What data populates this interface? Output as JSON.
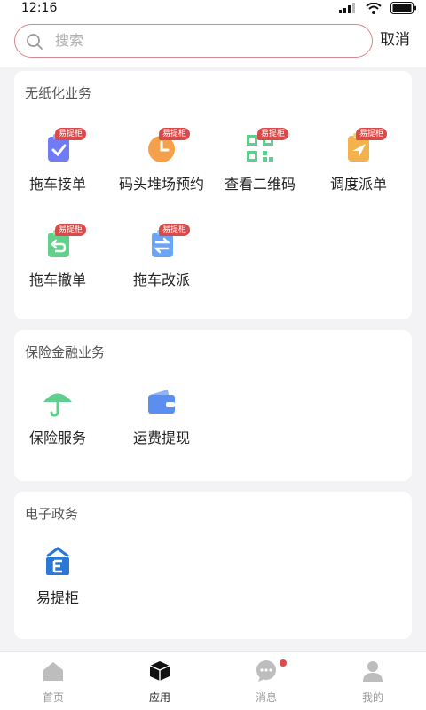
{
  "statusbar": {
    "time": "12:16"
  },
  "search": {
    "placeholder": "搜索",
    "cancel_label": "取消"
  },
  "sections": [
    {
      "title": "无纸化业务",
      "apps": [
        {
          "label": "拖车接单",
          "badge": "易提柜",
          "icon": "clipboard-check-icon",
          "color": "#6f7bf7"
        },
        {
          "label": "码头堆场预约",
          "badge": "易提柜",
          "icon": "clock-icon",
          "color": "#f5a04a"
        },
        {
          "label": "查看二维码",
          "badge": "易提柜",
          "icon": "qr-code-icon",
          "color": "#5ecf8c"
        },
        {
          "label": "调度派单",
          "badge": "易提柜",
          "icon": "send-icon",
          "color": "#f3b24e"
        },
        {
          "label": "拖车撤单",
          "badge": "易提柜",
          "icon": "undo-document-icon",
          "color": "#61d08a"
        },
        {
          "label": "拖车改派",
          "badge": "易提柜",
          "icon": "swap-document-icon",
          "color": "#6aa6f5"
        }
      ]
    },
    {
      "title": "保险金融业务",
      "apps": [
        {
          "label": "保险服务",
          "icon": "umbrella-icon",
          "color": "#5ecf8c"
        },
        {
          "label": "运费提现",
          "icon": "wallet-icon",
          "color": "#5b8ef0"
        }
      ]
    },
    {
      "title": "电子政务",
      "apps": [
        {
          "label": "易提柜",
          "icon": "e-box-icon",
          "color": "#2a78d6"
        }
      ]
    }
  ],
  "tabbar": [
    {
      "label": "首页",
      "icon": "home-icon"
    },
    {
      "label": "应用",
      "icon": "cube-icon",
      "active": true
    },
    {
      "label": "消息",
      "icon": "chat-icon",
      "has_dot": true
    },
    {
      "label": "我的",
      "icon": "user-icon"
    }
  ]
}
